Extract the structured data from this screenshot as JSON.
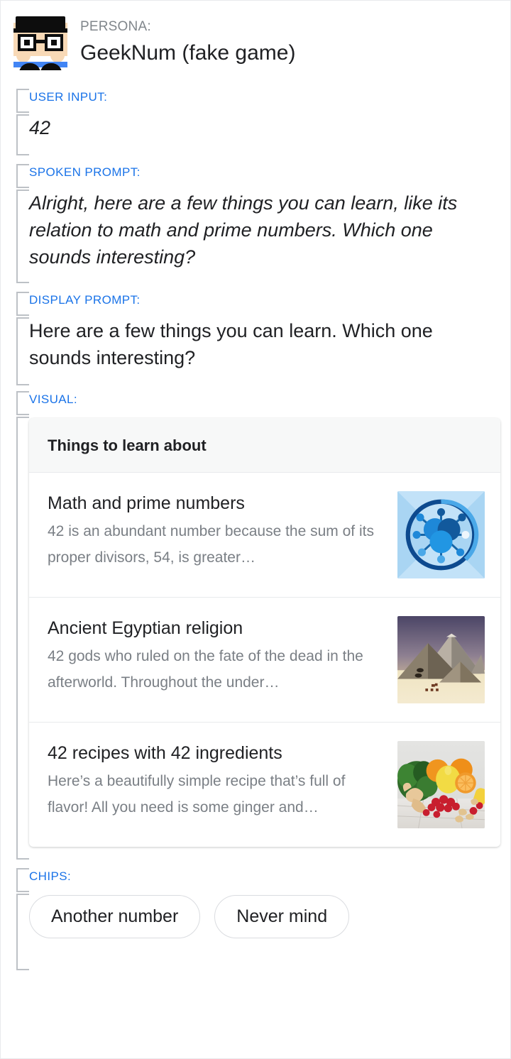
{
  "persona": {
    "label": "PERSONA:",
    "name": "GeekNum (fake game)",
    "avatar_icon": "geek-face-avatar-icon"
  },
  "sections": {
    "user_input": {
      "label": "USER INPUT:",
      "value": "42"
    },
    "spoken_prompt": {
      "label": "SPOKEN PROMPT:",
      "value": "Alright, here are a few things you can learn, like its relation to math and prime numbers. Which one sounds interesting?"
    },
    "display_prompt": {
      "label": "DISPLAY PROMPT:",
      "value": "Here are a few things you can learn. Which one sounds interesting?"
    },
    "visual": {
      "label": "VISUAL:"
    },
    "chips": {
      "label": "CHIPS:"
    }
  },
  "visual_card": {
    "header": "Things to learn about",
    "items": [
      {
        "title": "Math and prime numbers",
        "description": "42 is an abundant number because the sum of its proper divisors, 54, is greater…",
        "thumbnail_icon": "blue-network-nodes-icon"
      },
      {
        "title": "Ancient Egyptian religion",
        "description": "42 gods who ruled on the fate of the dead in the afterworld. Throughout the under…",
        "thumbnail_icon": "pyramids-of-giza-photo"
      },
      {
        "title": "42 recipes with 42 ingredients",
        "description": "Here’s a beautifully simple recipe that’s full of flavor! All you need is some ginger and…",
        "thumbnail_icon": "fresh-produce-photo"
      }
    ]
  },
  "chips": [
    {
      "label": "Another number"
    },
    {
      "label": "Never mind"
    }
  ],
  "colors": {
    "accent_blue": "#1a73e8",
    "bracket_gray": "#bdc1c6",
    "label_gray": "#80868b",
    "text_primary": "#202124",
    "desc_gray": "#7a7f85",
    "card_head_bg": "#f7f8f8",
    "divider": "#e8eaed"
  }
}
